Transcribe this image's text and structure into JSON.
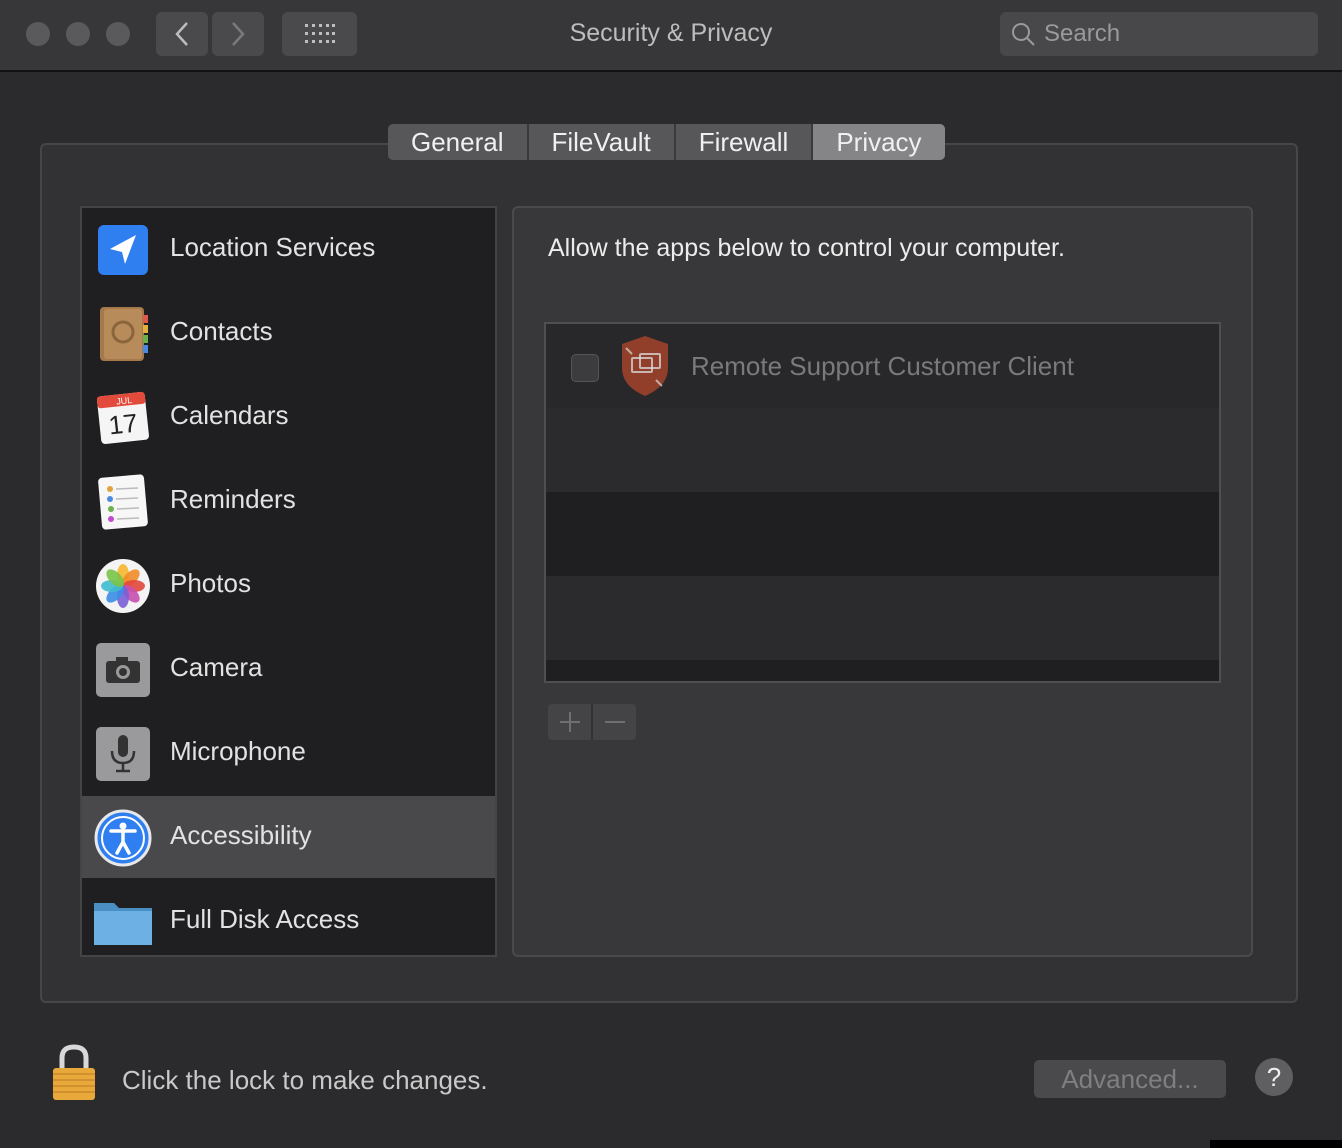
{
  "window": {
    "title": "Security & Privacy"
  },
  "search": {
    "placeholder": "Search"
  },
  "tabs": [
    {
      "label": "General",
      "active": false
    },
    {
      "label": "FileVault",
      "active": false
    },
    {
      "label": "Firewall",
      "active": false
    },
    {
      "label": "Privacy",
      "active": true
    }
  ],
  "sidebar": {
    "items": [
      {
        "label": "Location Services",
        "icon": "location-icon"
      },
      {
        "label": "Contacts",
        "icon": "contacts-icon"
      },
      {
        "label": "Calendars",
        "icon": "calendar-icon",
        "calendar_month": "JUL",
        "calendar_day": "17"
      },
      {
        "label": "Reminders",
        "icon": "reminders-icon"
      },
      {
        "label": "Photos",
        "icon": "photos-icon"
      },
      {
        "label": "Camera",
        "icon": "camera-icon"
      },
      {
        "label": "Microphone",
        "icon": "microphone-icon"
      },
      {
        "label": "Accessibility",
        "icon": "accessibility-icon",
        "selected": true
      },
      {
        "label": "Full Disk Access",
        "icon": "folder-icon"
      }
    ]
  },
  "main": {
    "heading": "Allow the apps below to control your computer.",
    "apps": [
      {
        "name": "Remote Support Customer Client",
        "checked": false,
        "icon": "remote-support-icon"
      }
    ]
  },
  "footer": {
    "lock_text": "Click the lock to make changes.",
    "advanced_label": "Advanced...",
    "help_label": "?"
  },
  "colors": {
    "accent_blue": "#2f7ff0",
    "app_icon_red": "#b4472b"
  }
}
